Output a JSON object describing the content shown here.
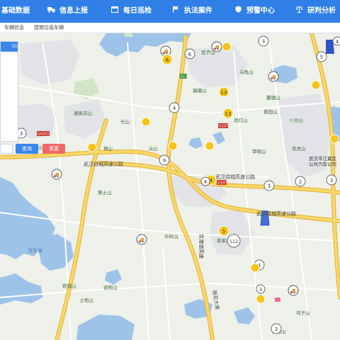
{
  "nav": {
    "items": [
      {
        "label": "基础数据",
        "icon": ""
      },
      {
        "label": "信息上报",
        "icon": "truck-icon"
      },
      {
        "label": "每日巡检",
        "icon": "calendar-icon"
      },
      {
        "label": "执法案件",
        "icon": "flag-icon"
      },
      {
        "label": "预警中心",
        "icon": "shield-icon"
      },
      {
        "label": "研判分析",
        "icon": "scales-icon"
      }
    ]
  },
  "breadcrumb": {
    "items": [
      "车辆信息",
      "建筑垃圾车辆"
    ]
  },
  "panel": {
    "header": "(5)"
  },
  "buttons": {
    "query": "查询",
    "reset": "重置"
  },
  "map": {
    "roads": [
      "武汉绕城高速公路",
      "武汉绕城高速公路",
      "武汉绕城高速公路",
      "京港澳高速",
      "雨花大道"
    ],
    "route_shields": [
      "G4201",
      "G107",
      "G107",
      "S11"
    ],
    "places": [
      "豆子山",
      "乌龟山",
      "瑞塘山",
      "谢家店山",
      "锅顶山",
      "长山",
      "神山",
      "尖山",
      "凤灯山",
      "葛园山",
      "八分山",
      "蔓塘山",
      "宰相山",
      "黄土山",
      "长岭山",
      "华羊湖",
      "铁铺山",
      "土地山",
      "道观山",
      "王县山",
      "蔡家山",
      "老虎山",
      "鸡子山",
      "武汉市江夏区",
      "公共汽车公司"
    ],
    "cluster_counts": [
      "6",
      "6",
      "3",
      "4",
      "4",
      "3",
      "5",
      "13",
      "13",
      "5",
      "9",
      "112",
      "4",
      "3",
      "3",
      "2",
      "3",
      "4",
      "4",
      "3"
    ]
  },
  "colors": {
    "nav": "#2f7fe6",
    "query_button": "#3b86ea",
    "reset_button": "#f06767",
    "cluster_yellow": "#f5c518",
    "road_yellow": "#f6cf5a"
  }
}
